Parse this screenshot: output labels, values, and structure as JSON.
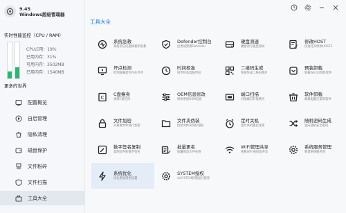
{
  "app": {
    "version": "9.45",
    "name": "Windows超级管理器"
  },
  "monitor": {
    "title": "实时性能监控（CPU / RAM）",
    "cpu_percent": 19,
    "mem_percent": 31,
    "cpu_label": "CPU占用：19%",
    "mem_label": "已用内存：31%",
    "total_mem_label": "可用内存：3502MB",
    "used_mem_label": "已用内存：1540MB"
  },
  "more_title": "更多的世界",
  "nav": [
    {
      "label": "配置概览",
      "icon": "overview-icon"
    },
    {
      "label": "自启管理",
      "icon": "startup-icon"
    },
    {
      "label": "隐私清理",
      "icon": "privacy-icon"
    },
    {
      "label": "磁盘保护",
      "icon": "disk-icon"
    },
    {
      "label": "文件粉碎",
      "icon": "shred-icon"
    },
    {
      "label": "文件扫描",
      "icon": "scan-icon"
    },
    {
      "label": "工具大全",
      "icon": "toolbox-icon"
    }
  ],
  "section_title": "工具大全",
  "tools": [
    {
      "name": "系统急救",
      "desc": "系统常见问题修复和急救",
      "icon": "rescue-icon"
    },
    {
      "name": "Defender控制台",
      "desc": "启用或禁用Defender",
      "icon": "shield-icon"
    },
    {
      "name": "硬盘测速",
      "desc": "硬盘读写速度测试",
      "icon": "hdd-icon"
    },
    {
      "name": "修改HOST",
      "desc": "快速打开修改HOSTS",
      "icon": "host-icon"
    },
    {
      "name": "坏点检测",
      "desc": "检测屏幕是否存在坏点",
      "icon": "pixel-icon"
    },
    {
      "name": "时间校准",
      "desc": "同步校准电脑时间",
      "icon": "clock-icon"
    },
    {
      "name": "二维码生成",
      "desc": "快速生成二维码图片",
      "icon": "qrcode-icon"
    },
    {
      "name": "预装卸载",
      "desc": "卸载Win10预装软件",
      "icon": "uninstall-icon"
    },
    {
      "name": "C盘瘦身",
      "desc": "清理C盘空间",
      "icon": "slim-icon"
    },
    {
      "name": "OEM信息修改",
      "desc": "修改系统OEM信息",
      "icon": "oem-icon"
    },
    {
      "name": "端口扫描",
      "desc": "扫描端口开放情况",
      "icon": "port-icon"
    },
    {
      "name": "软件卸载",
      "desc": "卸载电脑已安装软件",
      "icon": "software-icon"
    },
    {
      "name": "文件加密",
      "desc": "对重要文件进行加密",
      "icon": "encrypt-icon"
    },
    {
      "name": "文件夹伪装",
      "desc": "伪装文件夹保护隐私",
      "icon": "folder-icon"
    },
    {
      "name": "定时关机",
      "desc": "定时关机重启注销",
      "icon": "timer-icon"
    },
    {
      "name": "随机密码生成",
      "desc": "生成随机安全密码",
      "icon": "shuffle-icon"
    },
    {
      "name": "数字签名复制",
      "desc": "复制文件的数字签名",
      "icon": "signature-icon"
    },
    {
      "name": "批量更名",
      "desc": "批量修改文件名称",
      "icon": "rename-icon"
    },
    {
      "name": "WIFI管理共享",
      "desc": "查看WIFI密码及共享",
      "icon": "wifi-icon"
    },
    {
      "name": "系统服务管理",
      "desc": "管理系统服务项",
      "icon": "service-icon"
    },
    {
      "name": "系统优化",
      "desc": "优化系统常用设置",
      "icon": "optimize-icon"
    },
    {
      "name": "SYSTEM授权",
      "desc": "以SYSTEM权限运行程序",
      "icon": "system-icon"
    }
  ],
  "colors": {
    "accent": "#1b7ae8",
    "good": "#2bb673",
    "active_bg": "#e4ecf8"
  }
}
